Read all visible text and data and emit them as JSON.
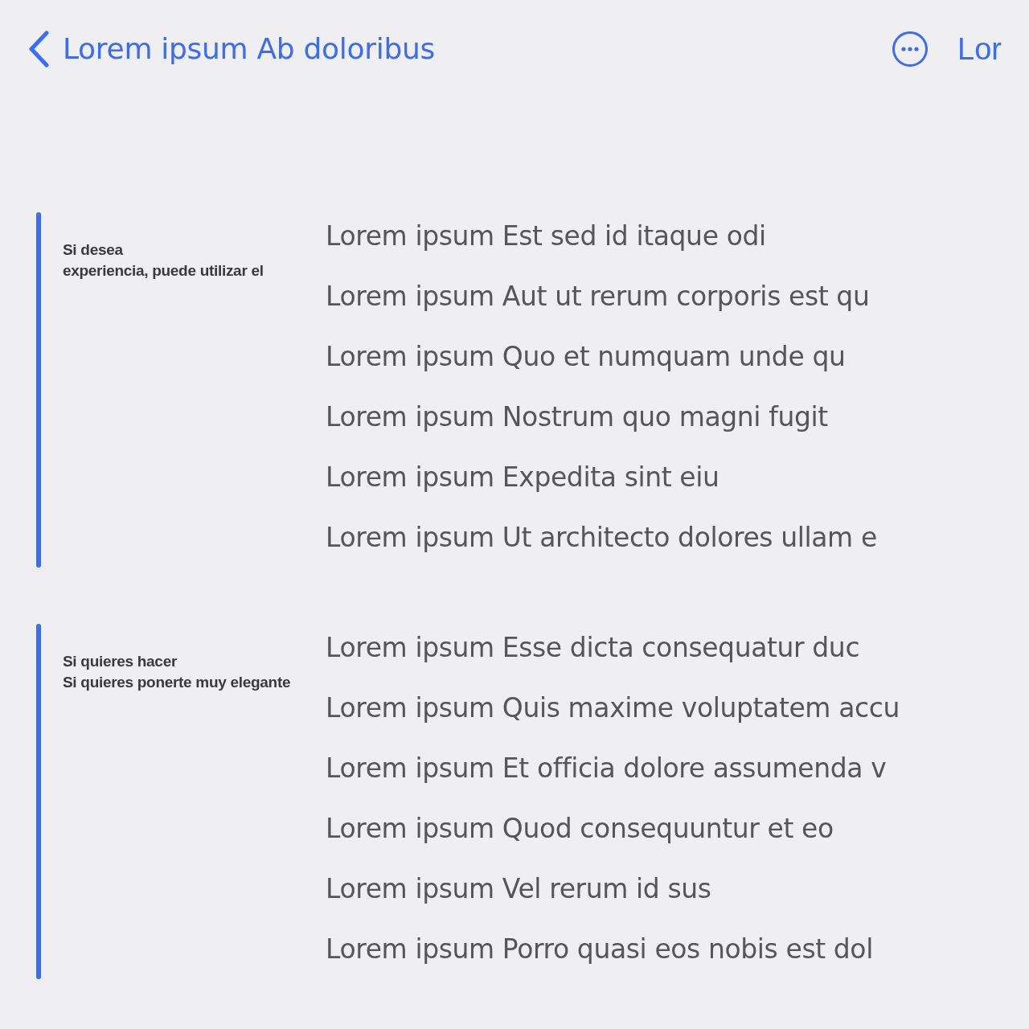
{
  "header": {
    "title": "Lorem ipsum Ab doloribus",
    "action": "Lor"
  },
  "sections": [
    {
      "label_lines": [
        "Si desea",
        "experiencia, puede utilizar el"
      ],
      "items": [
        "Lorem ipsum Est sed id itaque odi",
        "Lorem ipsum Aut ut rerum corporis est qu",
        "Lorem ipsum Quo et numquam unde qu",
        "Lorem ipsum Nostrum quo magni fugit",
        "Lorem ipsum Expedita sint eiu",
        "Lorem ipsum Ut architecto dolores ullam e"
      ]
    },
    {
      "label_lines": [
        "Si quieres hacer",
        "Si quieres ponerte muy elegante"
      ],
      "items": [
        "Lorem ipsum Esse dicta consequatur duc",
        "Lorem ipsum Quis maxime voluptatem accu",
        "Lorem ipsum Et officia dolore assumenda v",
        "Lorem ipsum Quod consequuntur et eo",
        "Lorem ipsum Vel rerum id sus",
        "Lorem ipsum Porro quasi eos nobis est dol"
      ]
    }
  ]
}
